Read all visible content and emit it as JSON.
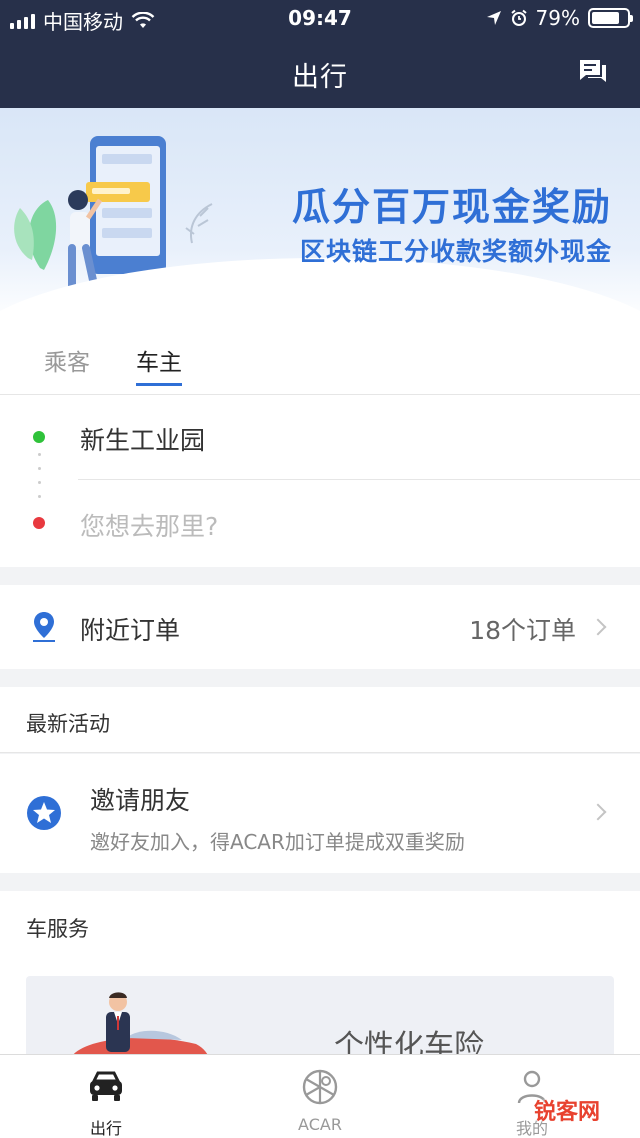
{
  "status_bar": {
    "carrier": "中国移动",
    "time": "09:47",
    "battery": "79%",
    "battery_level": 0.79
  },
  "nav": {
    "title": "出行",
    "message_icon": "chat-bubbles-icon"
  },
  "banner": {
    "title": "瓜分百万现金奖励",
    "subtitle": "区块链工分收款奖额外现金"
  },
  "tabs": [
    {
      "label": "乘客",
      "active": false
    },
    {
      "label": "车主",
      "active": true
    }
  ],
  "route": {
    "from": "新生工业园",
    "to_placeholder": "您想去那里?"
  },
  "nearby": {
    "label": "附近订单",
    "count": "18个订单"
  },
  "activities": {
    "header": "最新活动",
    "items": [
      {
        "title": "邀请朋友",
        "description": "邀好友加入，得ACAR加订单提成双重奖励"
      }
    ]
  },
  "car_services": {
    "header": "车服务",
    "card_title": "个性化车险"
  },
  "tabbar": [
    {
      "label": "出行",
      "icon": "car-icon",
      "active": true
    },
    {
      "label": "ACAR",
      "icon": "acar-logo-icon",
      "active": false
    },
    {
      "label": "我的",
      "icon": "user-icon",
      "active": false
    }
  ],
  "watermark": "锐客网",
  "colors": {
    "nav_bg": "#27304a",
    "accent": "#2f6fd6",
    "green": "#2fc23a",
    "red": "#e8393f"
  }
}
